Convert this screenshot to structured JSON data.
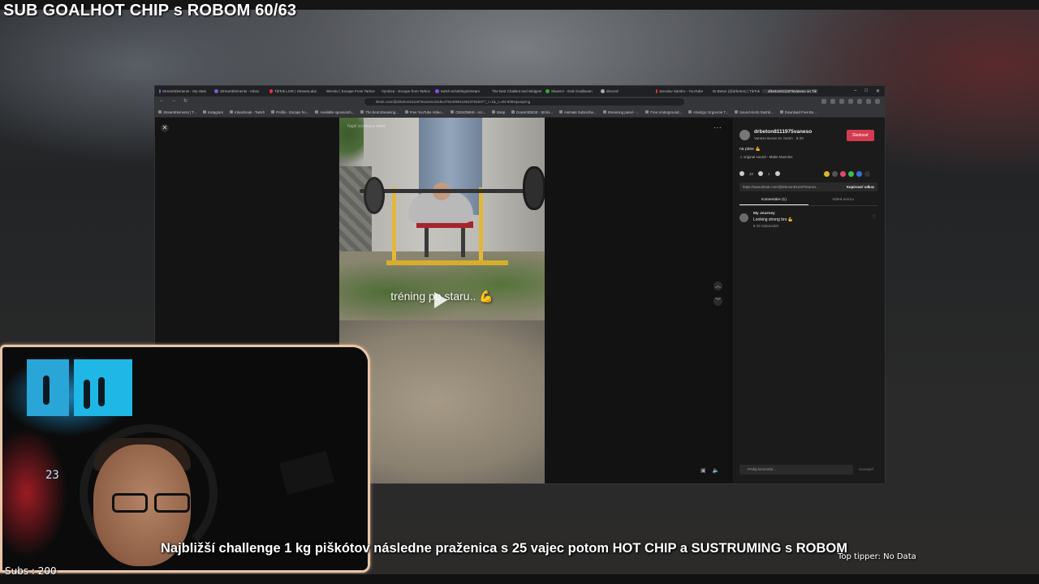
{
  "overlay": {
    "goal_text": "SUB GOALHOT CHIP s ROBOM 60/63",
    "subs_text": "Subs : 200",
    "ticker_text": "Najbližší challenge 1 kg piškótov následne praženica s 25 vajec potom HOT CHIP a SUSTRUMING s ROBOM",
    "top_tipper": "Top tipper: No Data"
  },
  "browser": {
    "tabs": [
      {
        "label": "StreamElements - My stats",
        "color": "#7b5cd6"
      },
      {
        "label": "StreamElements - Inbox",
        "color": "#7b5cd6"
      },
      {
        "label": "TikTok LIVE | StreamLabs",
        "color": "#e33"
      },
      {
        "label": "Wevolo | Escape From Tarkov",
        "color": "#aaa"
      },
      {
        "label": "Vyrobca - Escape from Tarkov",
        "color": "#aaa"
      },
      {
        "label": "twitch.tv/settings/stream",
        "color": "#9146ff"
      },
      {
        "label": "The best ChatBot and Widgets",
        "color": "#aaa"
      },
      {
        "label": "Skwerrz - Evik Goalbeam",
        "color": "#3a3"
      },
      {
        "label": "discord",
        "color": "#aaa"
      },
      {
        "label": "Jaroslav Sandro - YouTube",
        "color": "#e33"
      },
      {
        "label": "Dr.Beton (@drbeton) | TikTok",
        "color": "#222"
      },
      {
        "label": "drbeton8111975vaneso on TikTok",
        "color": "#222"
      }
    ],
    "url": "tiktok.com/@drbeton8111975vaneso/video/7544098119623752637?_r=1&_t=ZN-90BSpxaqrmg",
    "bookmarks": [
      "StreamElements | T...",
      "Instagram",
      "Inboxbreak - Twitch",
      "Profilo - Escape fro...",
      "Available sponsorsh...",
      "The best streaming...",
      "Free YouTube Video...",
      "CBS4DMH8 - Arc...",
      "Banp",
      "Downt4D5GE - Strimi...",
      "Animate Subscribe...",
      "Streaming panel - ...",
      "Free Underground...",
      "AlceEgo: ErgoAme T...",
      "Sound Alerts Dashb...",
      "Download Free Bo..."
    ]
  },
  "video": {
    "top_label": "Najdi súvisiace videá",
    "caption": "tréning po staru.. 💪"
  },
  "sidebar": {
    "username": "drbeton8111975vaneso",
    "subname": "Vaneso Buran Dr. betón · 8-29",
    "follow_label": "Sledovať",
    "description": "na páne 💪",
    "sound": "♫ original sound - Make Muscles",
    "likes": "22",
    "comments": "1",
    "link": "https://www.tiktok.com/@drbeton8111975vanes...",
    "copy_label": "Kopírovať odkaz",
    "tab_comments": "Komentáre (1)",
    "tab_creator": "Videá tvorcu",
    "comment": {
      "user": "My Journey",
      "text": "Looking strong bro 💪",
      "meta": "8-29    Odpovedať",
      "likes": "1"
    },
    "comment_placeholder": "Pridaj komentár...",
    "post_label": "Uverejniť"
  },
  "webcam": {
    "clock": "23"
  }
}
